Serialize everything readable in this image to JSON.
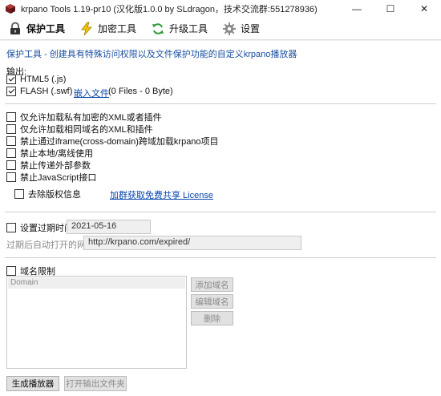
{
  "window": {
    "title": "krpano Tools 1.19-pr10   (汉化版1.0.0 by SLdragon，技术交流群:551278936)",
    "minimize": "—",
    "maximize": "☐",
    "close": "✕"
  },
  "toolbar": {
    "items": [
      {
        "label": "保护工具",
        "icon": "lock-icon"
      },
      {
        "label": "加密工具",
        "icon": "lightning-icon"
      },
      {
        "label": "升级工具",
        "icon": "refresh-icon"
      },
      {
        "label": "设置",
        "icon": "gear-icon"
      }
    ]
  },
  "description": {
    "label": "保护工具",
    "text": " - 创建具有特殊访问权限以及文件保护功能的自定义krpano播放器"
  },
  "output": {
    "heading": "输出:",
    "html5_label": "HTML5 (.js)",
    "html5_checked": true,
    "flash_label": "FLASH (.swf)",
    "flash_checked": true,
    "embed_link": "嵌入文件",
    "files_info": "(0 Files - 0 Byte)"
  },
  "options": [
    {
      "label": "仅允许加载私有加密的XML或者插件",
      "checked": false
    },
    {
      "label": "仅允许加载相同域名的XML和插件",
      "checked": false
    },
    {
      "label": "禁止通过iframe(cross-domain)跨域加载krpano项目",
      "checked": false
    },
    {
      "label": "禁止本地/离线使用",
      "checked": false
    },
    {
      "label": "禁止传递外部参数",
      "checked": false
    },
    {
      "label": "禁止JavaScript接口",
      "checked": false
    }
  ],
  "copyright": {
    "label": "去除版权信息",
    "checked": false,
    "license_link": "加群获取免费共享 License"
  },
  "expire": {
    "label": "设置过期时间:",
    "checked": false,
    "date_value": "2021-05-16",
    "redirect_label": "过期后自动打开的网页:",
    "redirect_value": "http://krpano.com/expired/"
  },
  "domain": {
    "label": "域名限制",
    "checked": false,
    "list_header": "Domain",
    "add_button": "添加域名",
    "edit_button": "编辑域名",
    "delete_button": "删除"
  },
  "footer": {
    "build_button": "生成播放器",
    "open_folder_button": "打开输出文件夹"
  }
}
